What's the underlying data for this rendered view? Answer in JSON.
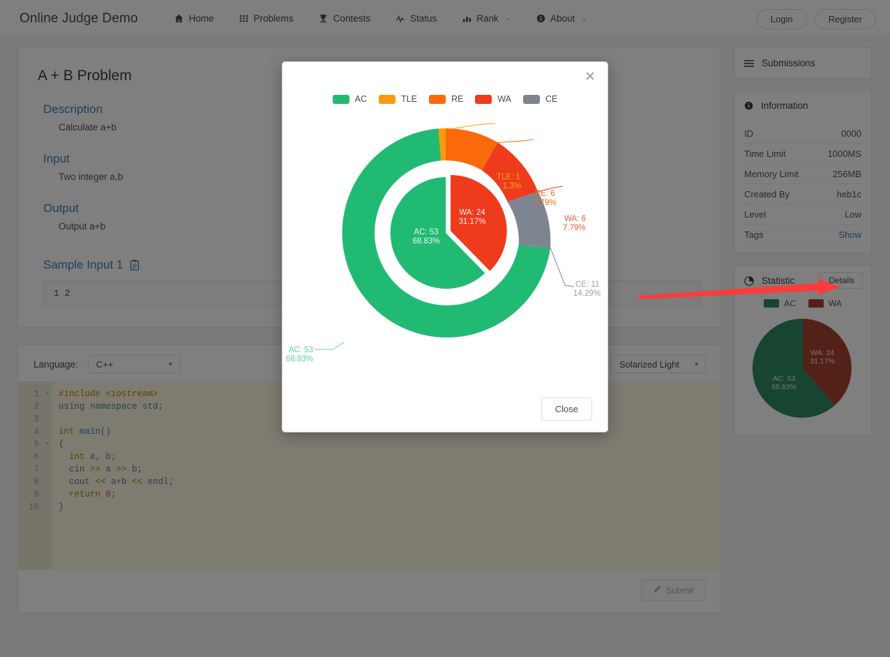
{
  "navbar": {
    "brand": "Online Judge Demo",
    "items": [
      {
        "label": "Home",
        "icon": "home-icon",
        "caret": ""
      },
      {
        "label": "Problems",
        "icon": "grid-icon",
        "caret": ""
      },
      {
        "label": "Contests",
        "icon": "trophy-icon",
        "caret": ""
      },
      {
        "label": "Status",
        "icon": "pulse-icon",
        "caret": ""
      },
      {
        "label": "Rank",
        "icon": "bar-chart-icon",
        "caret": "⌄"
      },
      {
        "label": "About",
        "icon": "info-icon",
        "caret": "⌄"
      }
    ],
    "login_label": "Login",
    "register_label": "Register"
  },
  "problem": {
    "title": "A + B Problem",
    "sections": [
      {
        "heading": "Description",
        "body": "Calculate a+b"
      },
      {
        "heading": "Input",
        "body": "Two integer a,b"
      },
      {
        "heading": "Output",
        "body": "Output a+b"
      }
    ],
    "sample_heading": "Sample Input 1",
    "sample_copy_icon": "clipboard-icon",
    "sample_value": "1 2"
  },
  "editor": {
    "language_label": "Language:",
    "language_value": "C++",
    "theme_value": "Solarized Light",
    "submit_label": "Submit",
    "submit_icon": "pencil-icon",
    "line_numbers": [
      "1",
      "2",
      "3",
      "4",
      "5",
      "6",
      "7",
      "8",
      "9",
      "10"
    ],
    "fold_markers": [
      "▾",
      "",
      "",
      "",
      "▾",
      "",
      "",
      "",
      "",
      ""
    ],
    "code_lines": [
      [
        {
          "t": "#include <iostream>",
          "c": "tok-pre"
        }
      ],
      [
        {
          "t": "using namespace std",
          "c": "tok-txt"
        },
        {
          "t": ";",
          "c": "tok-txt"
        }
      ],
      [
        {
          "t": "",
          "c": "tok-txt"
        }
      ],
      [
        {
          "t": "int",
          "c": "tok-kw"
        },
        {
          "t": " ",
          "c": "tok-txt"
        },
        {
          "t": "main",
          "c": "tok-fn"
        },
        {
          "t": "()",
          "c": "tok-txt"
        }
      ],
      [
        {
          "t": "{",
          "c": "tok-txt"
        }
      ],
      [
        {
          "t": "  ",
          "c": "tok-txt"
        },
        {
          "t": "int",
          "c": "tok-kw"
        },
        {
          "t": " a, b;",
          "c": "tok-txt"
        }
      ],
      [
        {
          "t": "  cin ",
          "c": "tok-txt"
        },
        {
          "t": ">>",
          "c": "tok-op"
        },
        {
          "t": " a ",
          "c": "tok-txt"
        },
        {
          "t": ">>",
          "c": "tok-op"
        },
        {
          "t": " b;",
          "c": "tok-txt"
        }
      ],
      [
        {
          "t": "  cout ",
          "c": "tok-txt"
        },
        {
          "t": "<<",
          "c": "tok-op"
        },
        {
          "t": " a+b ",
          "c": "tok-txt"
        },
        {
          "t": "<<",
          "c": "tok-op"
        },
        {
          "t": " endl;",
          "c": "tok-txt"
        }
      ],
      [
        {
          "t": "  ",
          "c": "tok-txt"
        },
        {
          "t": "return",
          "c": "tok-kw"
        },
        {
          "t": " ",
          "c": "tok-txt"
        },
        {
          "t": "0",
          "c": "tok-num"
        },
        {
          "t": ";",
          "c": "tok-txt"
        }
      ],
      [
        {
          "t": "}",
          "c": "tok-txt"
        }
      ]
    ]
  },
  "sidebar": {
    "submissions": {
      "label": "Submissions",
      "icon": "list-icon"
    },
    "information": {
      "label": "Information",
      "icon": "info-circle-icon",
      "rows": [
        {
          "key": "ID",
          "value": "0000",
          "link": false
        },
        {
          "key": "Time Limit",
          "value": "1000MS",
          "link": false
        },
        {
          "key": "Memory Limit",
          "value": "256MB",
          "link": false
        },
        {
          "key": "Created By",
          "value": "heb1c",
          "link": false
        },
        {
          "key": "Level",
          "value": "Low",
          "link": false
        },
        {
          "key": "Tags",
          "value": "Show",
          "link": true
        }
      ]
    },
    "statistic": {
      "label": "Statistic",
      "icon": "pie-chart-icon",
      "details_label": "Details"
    }
  },
  "modal": {
    "close_icon": "close-icon",
    "close_button_label": "Close",
    "legend": [
      {
        "label": "AC",
        "color": "#21BA72"
      },
      {
        "label": "TLE",
        "color": "#FA9A0C"
      },
      {
        "label": "RE",
        "color": "#FB6A0A"
      },
      {
        "label": "WA",
        "color": "#EE3B1C"
      },
      {
        "label": "CE",
        "color": "#7E8490"
      }
    ]
  },
  "annotation": {
    "arrow_color": "#FA3C3C",
    "points_to": "details-button"
  },
  "chart_data": [
    {
      "id": "modal-donut",
      "type": "pie",
      "title": "",
      "legend_position": "top",
      "rings": [
        {
          "name": "outer",
          "labels": [
            "AC",
            "TLE",
            "RE",
            "WA",
            "CE"
          ],
          "values": [
            53,
            1,
            6,
            6,
            11
          ],
          "percents": [
            "68.83%",
            "1.3%",
            "7.79%",
            "7.79%",
            "14.29%"
          ],
          "colors": [
            "#21BA72",
            "#FA9A0C",
            "#FB6A0A",
            "#EE3B1C",
            "#7E8490"
          ],
          "data_labels": [
            "AC: 53",
            "TLE: 1",
            "RE: 6",
            "WA: 6",
            "CE: 11"
          ],
          "label_placement": "outside"
        },
        {
          "name": "inner",
          "labels": [
            "AC",
            "WA"
          ],
          "values": [
            53,
            24
          ],
          "percents": [
            "68.83%",
            "31.17%"
          ],
          "colors": [
            "#21BA72",
            "#EE3B1C"
          ],
          "data_labels": [
            "AC: 53",
            "WA: 24"
          ],
          "label_placement": "inside",
          "exploded_slice": "WA"
        }
      ]
    },
    {
      "id": "sidebar-pie",
      "type": "pie",
      "title": "",
      "legend_position": "top",
      "labels": [
        "AC",
        "WA"
      ],
      "values": [
        53,
        24
      ],
      "percents": [
        "68.83%",
        "31.17%"
      ],
      "colors": [
        "#2E8B63",
        "#A84232"
      ],
      "data_labels": [
        "AC: 53",
        "WA: 24"
      ]
    }
  ]
}
